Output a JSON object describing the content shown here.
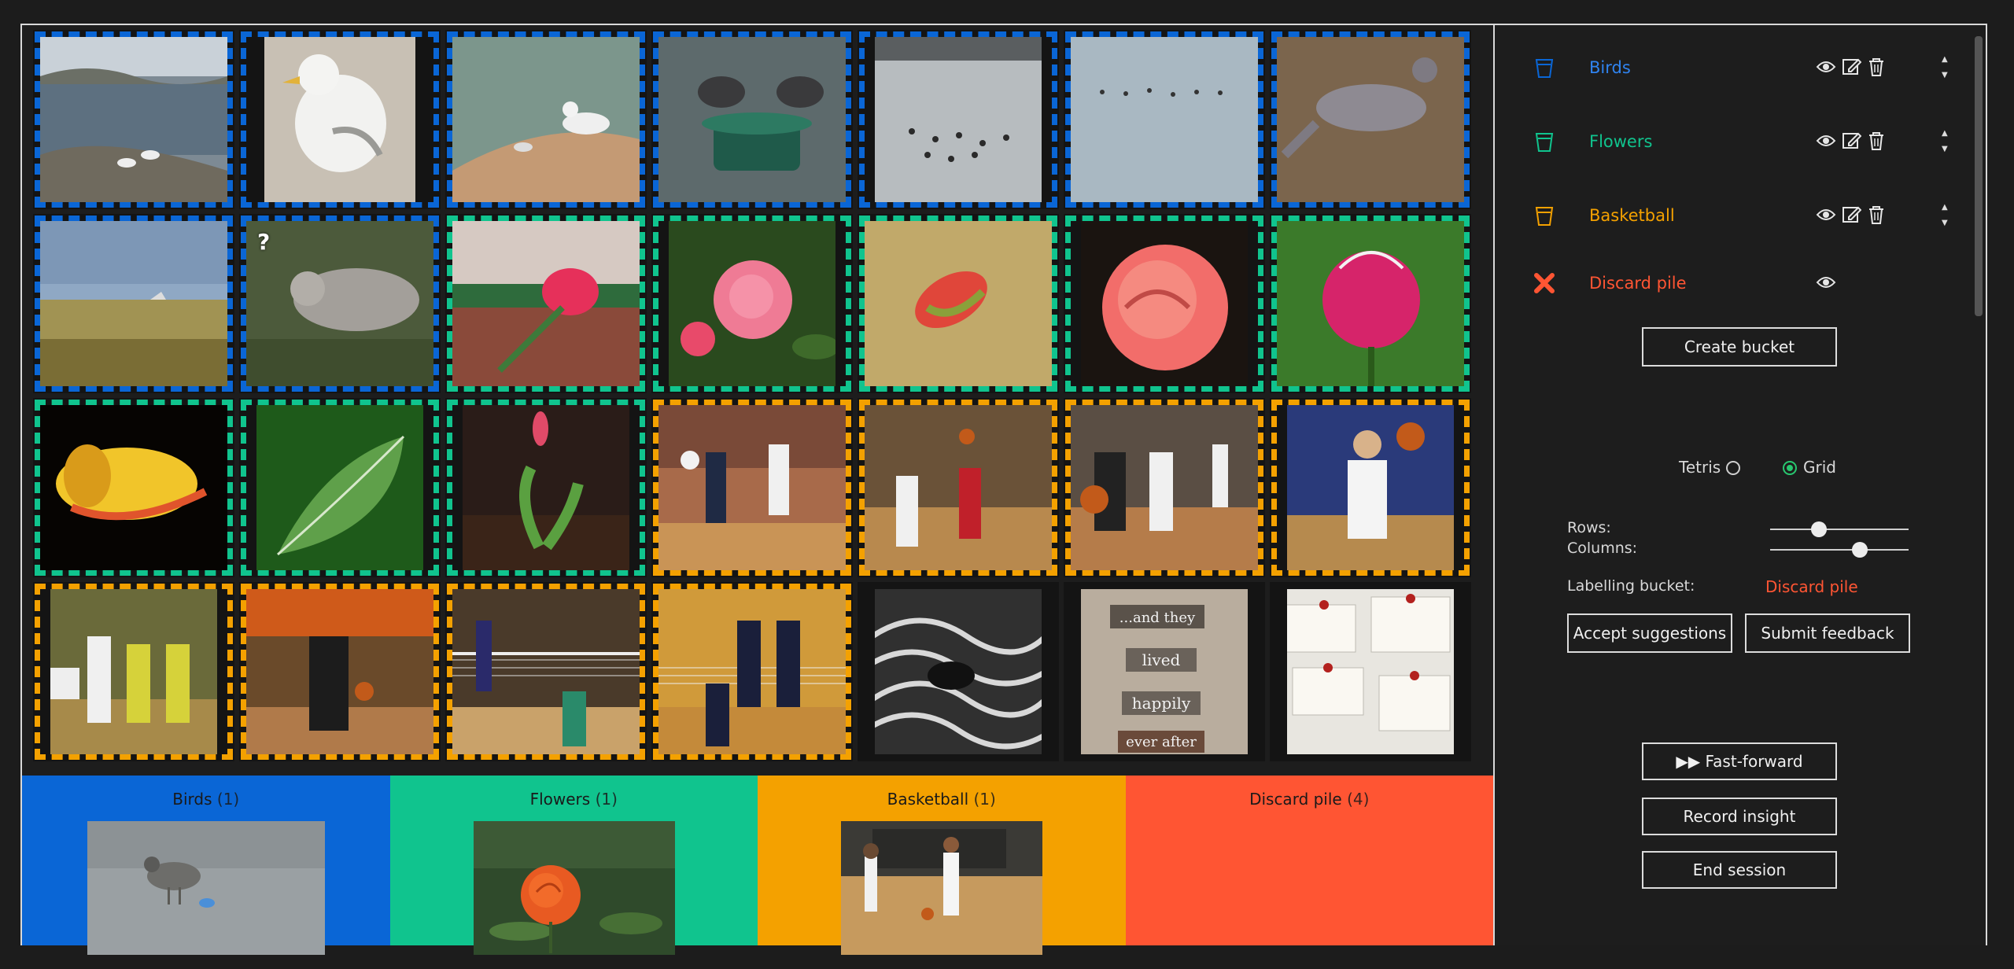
{
  "colors": {
    "birds": "#0a66d6",
    "flowers": "#10c48e",
    "basketball": "#f4a100",
    "discard": "#ff5533",
    "background": "#1d1d1d"
  },
  "grid": {
    "tiles": [
      {
        "bucket": "birds",
        "desc": "harbor with seagulls on rocks"
      },
      {
        "bucket": "birds",
        "desc": "seagull standing"
      },
      {
        "bucket": "birds",
        "desc": "gulls on shore rock"
      },
      {
        "bucket": "birds",
        "desc": "pigeons on feeder"
      },
      {
        "bucket": "birds",
        "desc": "ducks on lake"
      },
      {
        "bucket": "birds",
        "desc": "birds on water"
      },
      {
        "bucket": "birds",
        "desc": "dove on ground"
      },
      {
        "bucket": "birds",
        "desc": "bird over grassland"
      },
      {
        "bucket": "birds",
        "desc": "dove in grass",
        "question": "?"
      },
      {
        "bucket": "flowers",
        "desc": "pink tulip bud"
      },
      {
        "bucket": "flowers",
        "desc": "pink rose"
      },
      {
        "bucket": "flowers",
        "desc": "rose bud on yellow"
      },
      {
        "bucket": "flowers",
        "desc": "pink rose close-up"
      },
      {
        "bucket": "flowers",
        "desc": "peony bud"
      },
      {
        "bucket": "flowers",
        "desc": "yellow rose"
      },
      {
        "bucket": "flowers",
        "desc": "green leaves"
      },
      {
        "bucket": "flowers",
        "desc": "tulip in soil"
      },
      {
        "bucket": "basketball",
        "desc": "volleyball players"
      },
      {
        "bucket": "basketball",
        "desc": "basketball shooting"
      },
      {
        "bucket": "basketball",
        "desc": "basketball game"
      },
      {
        "bucket": "basketball",
        "desc": "basketball player shooting"
      },
      {
        "bucket": "basketball",
        "desc": "women's basketball"
      },
      {
        "bucket": "basketball",
        "desc": "player dribbling"
      },
      {
        "bucket": "basketball",
        "desc": "volleyball at net"
      },
      {
        "bucket": "basketball",
        "desc": "volleyball block"
      },
      {
        "bucket": "none",
        "desc": "rope coil"
      },
      {
        "bucket": "none",
        "desc": "and they lived happily ever after"
      },
      {
        "bucket": "none",
        "desc": "notes pinned on board"
      }
    ]
  },
  "bucket_bar": [
    {
      "name": "Birds",
      "count": "(1)"
    },
    {
      "name": "Flowers",
      "count": "(1)"
    },
    {
      "name": "Basketball",
      "count": "(1)"
    },
    {
      "name": "Discard pile",
      "count": "(4)"
    }
  ],
  "sidebar": {
    "buckets": [
      {
        "name": "Birds",
        "icon": "bucket-icon"
      },
      {
        "name": "Flowers",
        "icon": "bucket-icon"
      },
      {
        "name": "Basketball",
        "icon": "bucket-icon"
      },
      {
        "name": "Discard pile",
        "icon": "cross-icon"
      }
    ],
    "create_bucket": "Create bucket",
    "layout": {
      "tetris": "Tetris",
      "grid": "Grid",
      "selected": "Grid"
    },
    "rows_label": "Rows:",
    "columns_label": "Columns:",
    "rows_value": 0.35,
    "columns_value": 0.65,
    "labelling_label": "Labelling bucket:",
    "labelling_value": "Discard pile",
    "accept": "Accept suggestions",
    "submit": "Submit feedback",
    "fast_forward": "▶▶ Fast-forward",
    "record": "Record insight",
    "end": "End session"
  }
}
